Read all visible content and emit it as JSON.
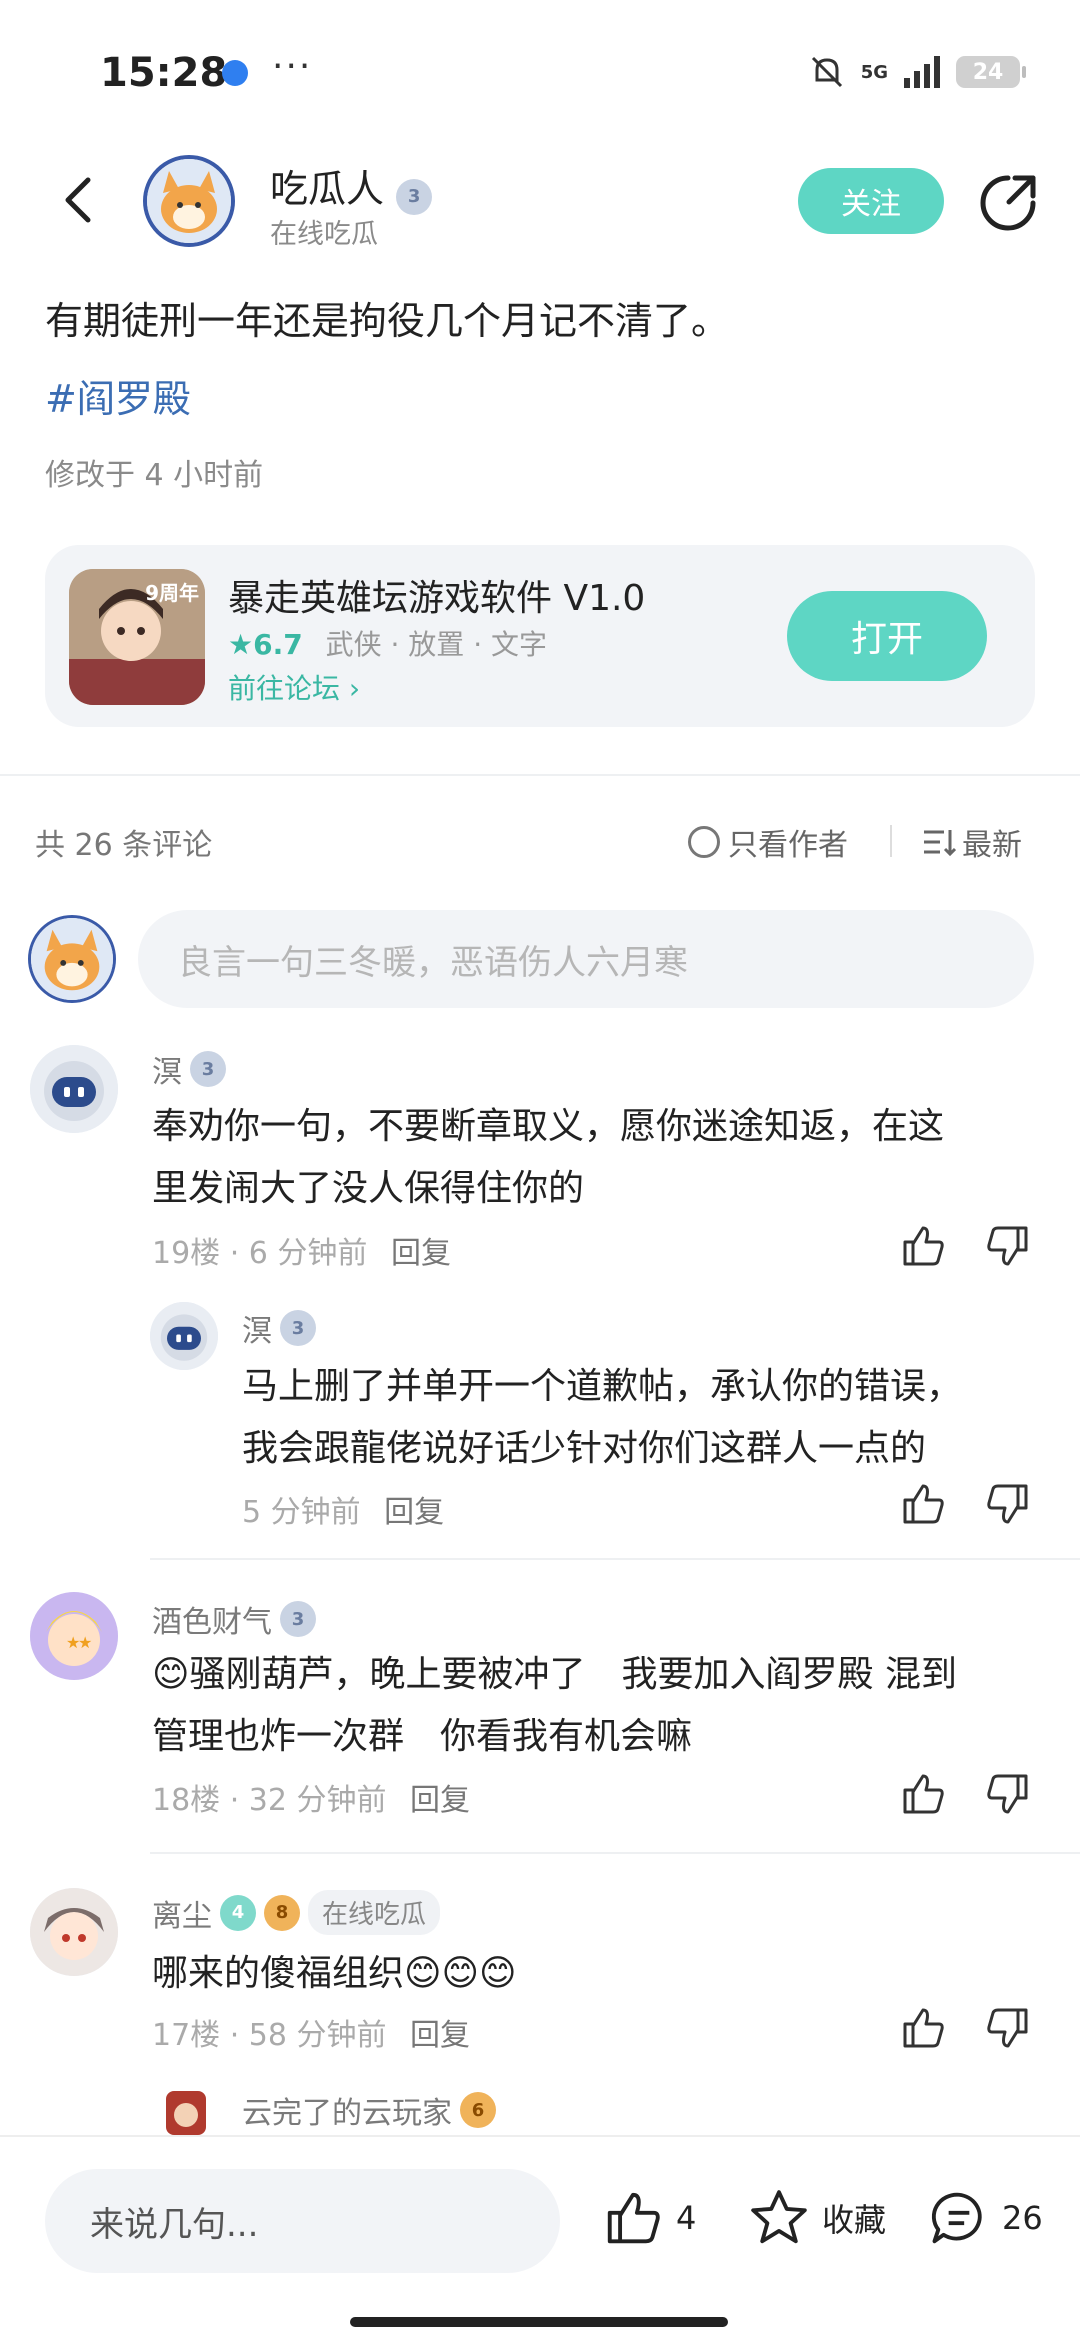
{
  "status_bar": {
    "time": "15:28",
    "more": "···",
    "network": "5G",
    "battery": "24"
  },
  "header": {
    "author_name": "吃瓜人",
    "author_level": "3",
    "author_status": "在线吃瓜",
    "follow_label": "关注"
  },
  "post": {
    "text": "有期徒刑一年还是拘役几个月记不清了。",
    "tag": "#阎罗殿",
    "edited": "修改于 4 小时前"
  },
  "game_card": {
    "title": "暴走英雄坛游戏软件 V1.0",
    "rating": "★6.7",
    "tags": "武侠 · 放置 · 文字",
    "link": "前往论坛 ›",
    "icon_caption": "9周年",
    "open_label": "打开"
  },
  "comments_header": {
    "count": "共 26 条评论",
    "only_author": "只看作者",
    "sort": "最新"
  },
  "comment_input": {
    "placeholder": "良言一句三冬暖，恶语伤人六月寒"
  },
  "comments": [
    {
      "name": "溟",
      "level": "3",
      "text1": "奉劝你一句，不要断章取义，愿你迷途知返，在这",
      "text2": "里发闹大了没人保得住你的",
      "meta": "19楼 · 6 分钟前",
      "reply": "回复"
    },
    {
      "name": "溟",
      "level": "3",
      "text1": "马上删了并单开一个道歉帖，承认你的错误，",
      "text2": "我会跟龍佬说好话少针对你们这群人一点的",
      "meta": "5 分钟前",
      "reply": "回复"
    },
    {
      "name": "酒色财气",
      "level": "3",
      "text1": "😊骚刚葫芦，晚上要被冲了　我要加入阎罗殿 混到",
      "text2": "管理也炸一次群　你看我有机会嘛",
      "meta": "18楼 · 32 分钟前",
      "reply": "回复"
    },
    {
      "name": "离尘",
      "badge1": "4",
      "level": "8",
      "tag": "在线吃瓜",
      "text1": "哪来的傻福组织😊😊😊",
      "meta": "17楼 · 58 分钟前",
      "reply": "回复"
    },
    {
      "name": "云完了的云玩家",
      "level": "6"
    }
  ],
  "bottom_bar": {
    "input_placeholder": "来说几句...",
    "likes": "4",
    "favorite_label": "收藏",
    "comments": "26"
  },
  "colors": {
    "accent": "#5ed6c4",
    "tag": "#3b6db3",
    "rating": "#3ab7a3"
  }
}
